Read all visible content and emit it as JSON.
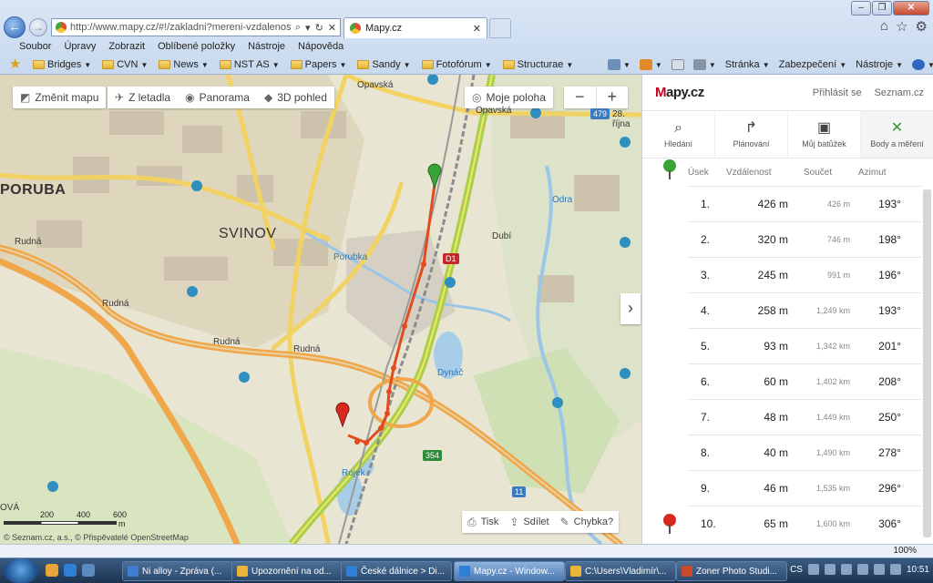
{
  "browser": {
    "url": "http://www.mapy.cz/#!/zakladni?mereni-vzdalenosti&x=",
    "tab_title": "Mapy.cz",
    "menu": [
      "Soubor",
      "Úpravy",
      "Zobrazit",
      "Oblíbené položky",
      "Nástroje",
      "Nápověda"
    ],
    "favorites": [
      "Bridges",
      "CVN",
      "News",
      "NST AS",
      "Papers",
      "Sandy",
      "Fotofórum",
      "Structurae"
    ],
    "commands": [
      "Stránka",
      "Zabezpečení",
      "Nástroje"
    ]
  },
  "map": {
    "buttons": {
      "change_map": "Změnit mapu",
      "aerial": "Z letadla",
      "panorama": "Panorama",
      "view3d": "3D pohled",
      "my_location": "Moje poloha"
    },
    "zoom_out": "−",
    "zoom_in": "+",
    "collapse": "›",
    "labels": {
      "poruba": "PORUBA",
      "svinov": "SVINOV",
      "opavska1": "Opavská",
      "opavska2": "Opavská",
      "rudna1": "Rudná",
      "rudna2": "Rudná",
      "rudna3": "Rudná",
      "rudna4": "Rudná",
      "porubka": "Porubka",
      "dubi": "Dubí",
      "odra": "Odra",
      "dynac": "Dynáč",
      "rojek": "Rojek",
      "ova": "OVÁ",
      "rijna": "28. října"
    },
    "shields": {
      "r479": "479",
      "d1": "D1",
      "r354": "354",
      "r11": "11"
    },
    "scale": [
      "200",
      "400",
      "600",
      "m"
    ],
    "copyright": "© Seznam.cz, a.s., © Přispěvatelé OpenStreetMap",
    "share": {
      "print": "Tisk",
      "share": "Sdílet",
      "error": "Chybka?"
    }
  },
  "panel": {
    "brand": "Mapy.cz",
    "login": "Přihlásit se",
    "seznam": "Seznam.cz",
    "tabs": [
      "Hledání",
      "Plánování",
      "Můj batůžek",
      "Body a měření"
    ],
    "headers": {
      "segment": "Úsek",
      "distance": "Vzdálenost",
      "sum": "Součet",
      "azimuth": "Azimut"
    },
    "rows": [
      {
        "n": "1.",
        "d": "426 m",
        "s": "426 m",
        "a": "193°"
      },
      {
        "n": "2.",
        "d": "320 m",
        "s": "746 m",
        "a": "198°"
      },
      {
        "n": "3.",
        "d": "245 m",
        "s": "991 m",
        "a": "196°"
      },
      {
        "n": "4.",
        "d": "258 m",
        "s": "1,249 km",
        "a": "193°"
      },
      {
        "n": "5.",
        "d": "93 m",
        "s": "1,342 km",
        "a": "201°"
      },
      {
        "n": "6.",
        "d": "60 m",
        "s": "1,402 km",
        "a": "208°"
      },
      {
        "n": "7.",
        "d": "48 m",
        "s": "1,449 km",
        "a": "250°"
      },
      {
        "n": "8.",
        "d": "40 m",
        "s": "1,490 km",
        "a": "278°"
      },
      {
        "n": "9.",
        "d": "46 m",
        "s": "1,535 km",
        "a": "296°"
      },
      {
        "n": "10.",
        "d": "65 m",
        "s": "1,600 km",
        "a": "306°"
      }
    ]
  },
  "status": {
    "zoom": "100%"
  },
  "taskbar": {
    "tasks": [
      "Ni alloy - Zpráva (...",
      "Upozornění na od...",
      "České dálnice > Di...",
      "Mapy.cz - Window...",
      "C:\\Users\\Vladimír\\...",
      "Zoner Photo Studi..."
    ],
    "lang": "CS",
    "time": "10:51"
  }
}
